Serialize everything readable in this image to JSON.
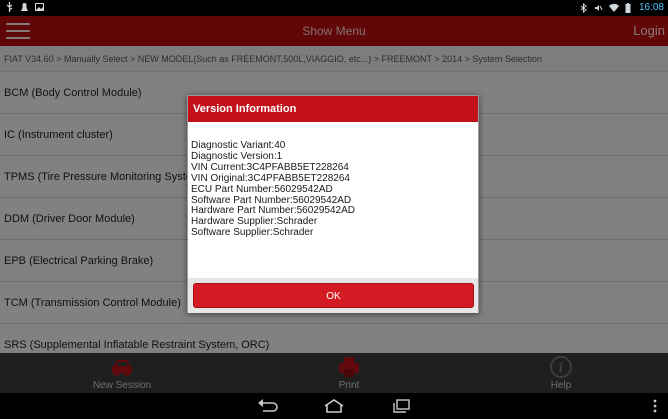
{
  "status_bar": {
    "time": "16:08",
    "left_icons": [
      "usb-icon",
      "notification-icon",
      "image-icon"
    ],
    "right_icons": [
      "bluetooth-icon",
      "mute-icon",
      "wifi-icon",
      "battery-icon"
    ]
  },
  "app_bar": {
    "title": "Show Menu",
    "login_label": "Login"
  },
  "breadcrumb": "FIAT V34.60 > Manually Select > NEW MODEL(Such as FREEMONT,500L,VIAGGIO, etc...) > FREEMONT > 2014 > System Selection",
  "systems": [
    "BCM (Body Control Module)",
    "IC (Instrument cluster)",
    "TPMS (Tire Pressure Monitoring System)",
    "DDM (Driver Door Module)",
    "EPB (Electrical Parking Brake)",
    "TCM (Transmission Control Module)",
    "SRS (Supplemental Inflatable Restraint System, ORC)"
  ],
  "dialog": {
    "title": "Version Information",
    "lines": [
      "Diagnostic Variant:40",
      "Diagnostic Version:1",
      "VIN Current:3C4PFABB5ET228264",
      "VIN Original:3C4PFABB5ET228264",
      "ECU Part Number:56029542AD",
      "Software Part Number:56029542AD",
      "Hardware Part Number:56029542AD",
      "Hardware Supplier:Schrader",
      "Software Supplier:Schrader"
    ],
    "ok_label": "OK"
  },
  "bottom_bar": {
    "new_session": "New Session",
    "print": "Print",
    "help": "Help"
  },
  "nav_bar": {
    "icons": [
      "back-icon",
      "home-icon",
      "recents-icon",
      "overflow-menu-icon"
    ]
  },
  "colors": {
    "brand_red": "#b30d0d",
    "dialog_header": "#c2111b",
    "ok_button": "#d41a22",
    "clock": "#4fc3f7"
  }
}
